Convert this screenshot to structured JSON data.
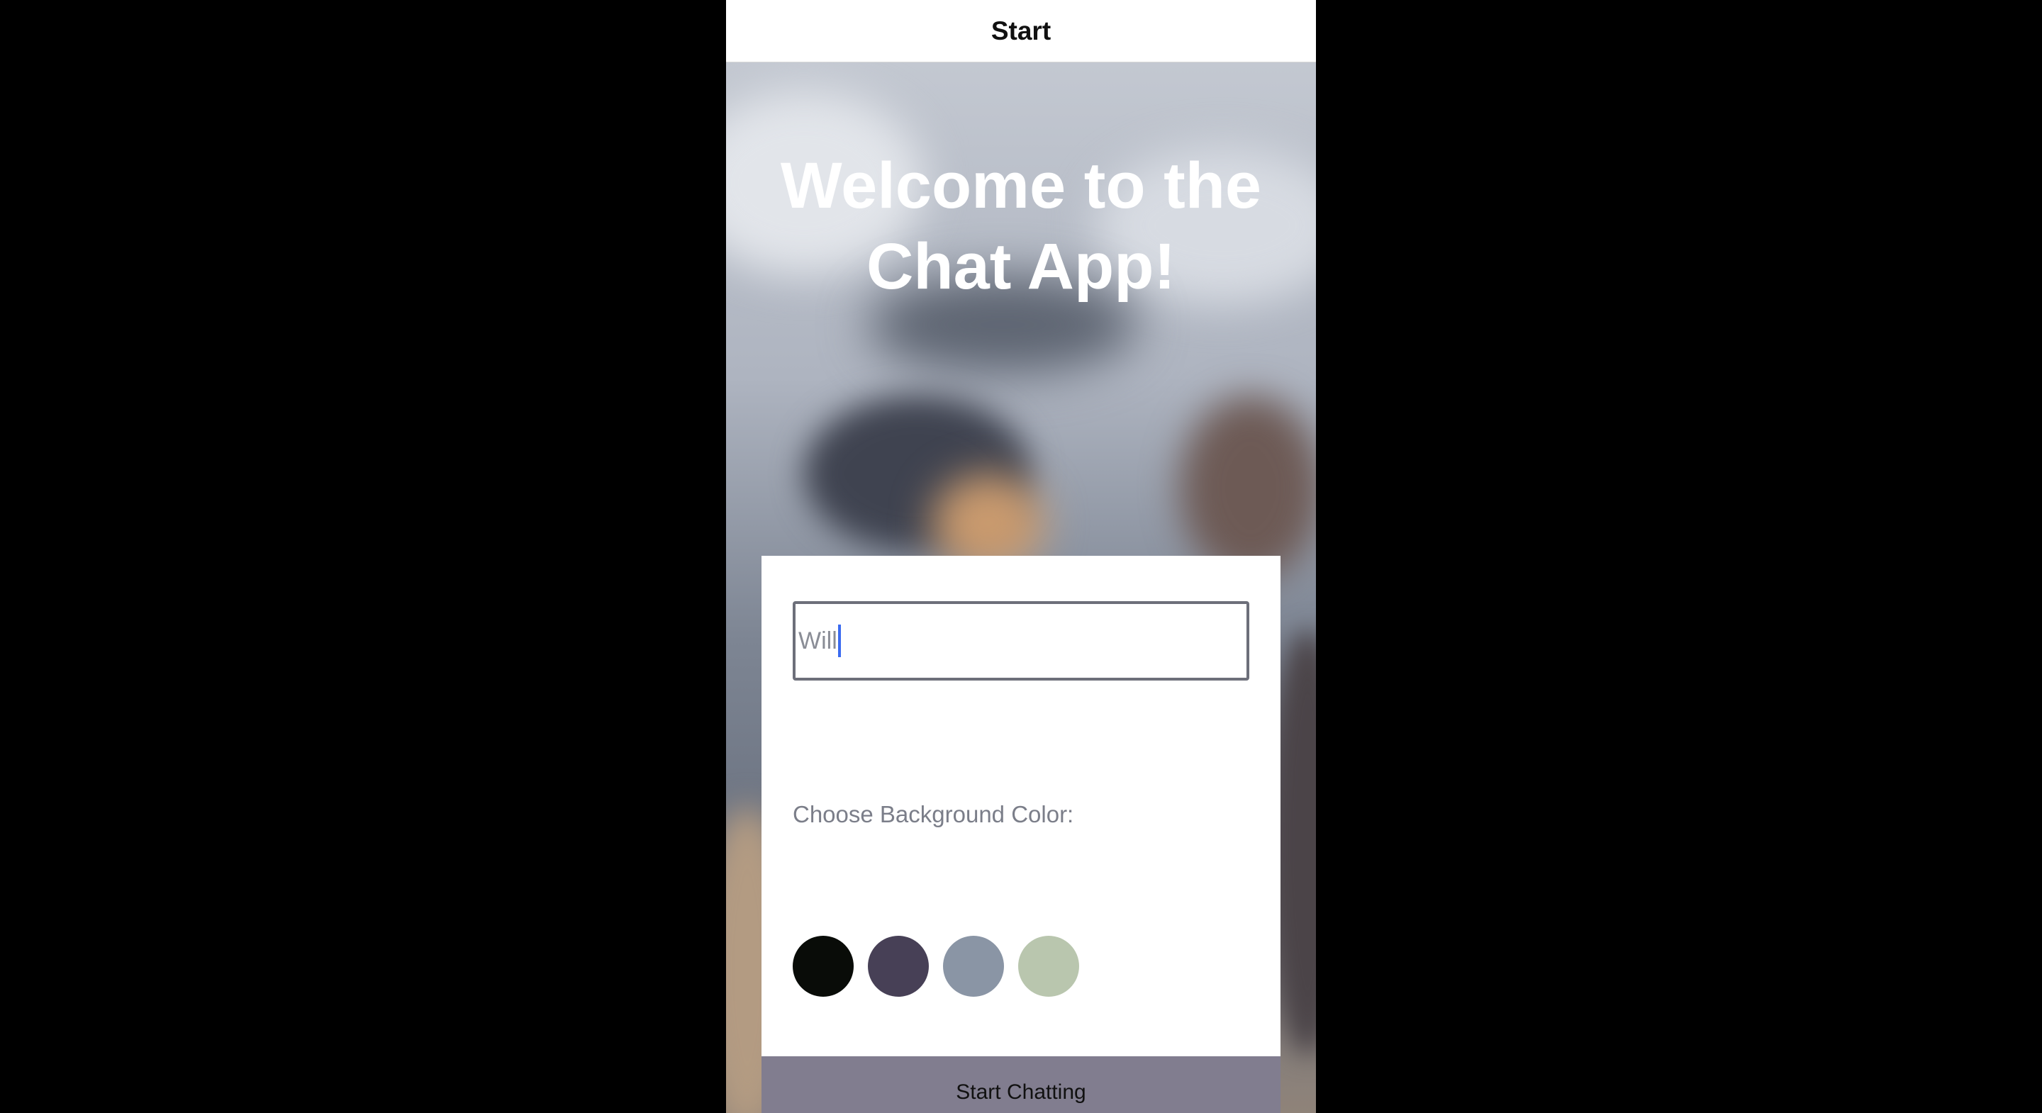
{
  "nav": {
    "title": "Start"
  },
  "hero": {
    "title": "Welcome to the\nChat App!"
  },
  "form": {
    "name_input": {
      "value": "Will"
    },
    "background_label": "Choose Background Color:",
    "colors": [
      "#090C08",
      "#474056",
      "#8A95A5",
      "#B9C6AE"
    ],
    "submit_label": "Start Chatting"
  }
}
